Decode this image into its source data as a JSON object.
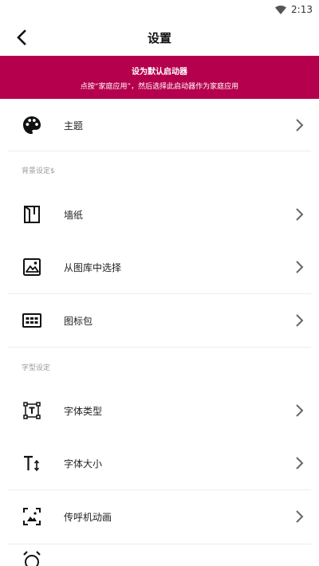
{
  "status_bar": {
    "time": "2:13"
  },
  "header": {
    "title": "设置"
  },
  "banner": {
    "title": "设为默认启动器",
    "subtitle": "点按“家庭应用”，然后选择此启动器作为家庭应用",
    "color": "#b5004d"
  },
  "sections": {
    "background": "背景设定$",
    "font": "字型设定"
  },
  "items": [
    {
      "label": "主题",
      "icon": "palette-icon"
    },
    {
      "label": "墙纸",
      "icon": "wallpaper-icon"
    },
    {
      "label": "从图库中选择",
      "icon": "gallery-icon"
    },
    {
      "label": "图标包",
      "icon": "icon-pack-icon"
    },
    {
      "label": "字体类型",
      "icon": "font-type-icon"
    },
    {
      "label": "字体大小",
      "icon": "font-size-icon"
    },
    {
      "label": "传呼机动画",
      "icon": "animation-icon"
    }
  ]
}
